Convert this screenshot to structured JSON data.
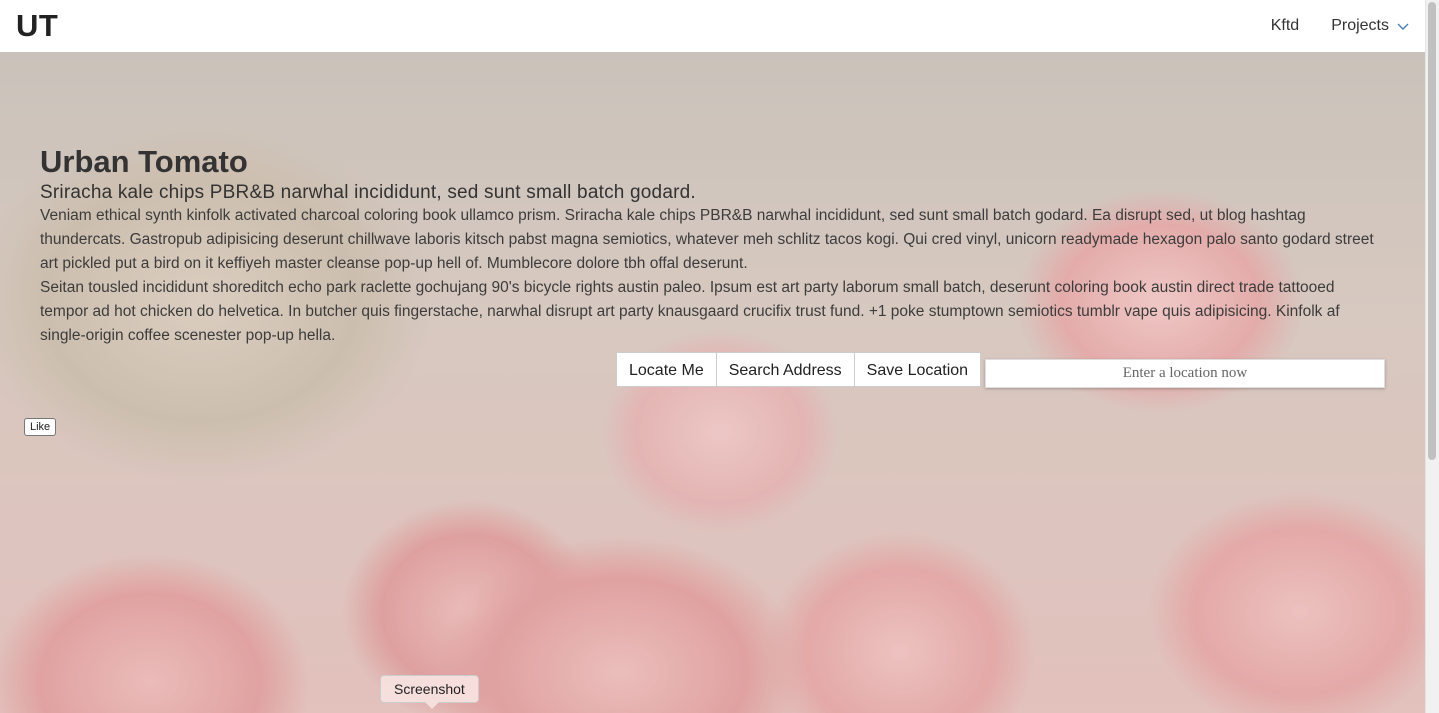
{
  "nav": {
    "brand": "UT",
    "links": [
      {
        "label": "Kftd"
      },
      {
        "label": "Projects",
        "icon": "chevron-down-icon"
      }
    ]
  },
  "hero": {
    "title": "Urban Tomato",
    "subtitle": "Sriracha kale chips PBR&B narwhal incididunt, sed sunt small batch godard.",
    "paragraphs": [
      "Veniam ethical synth kinfolk activated charcoal coloring book ullamco prism. Sriracha kale chips PBR&B narwhal incididunt, sed sunt small batch godard. Ea disrupt sed, ut blog hashtag thundercats. Gastropub adipisicing deserunt chillwave laboris kitsch pabst magna semiotics, whatever meh schlitz tacos kogi. Qui cred vinyl, unicorn readymade hexagon palo santo godard street art pickled put a bird on it keffiyeh master cleanse pop-up hell of. Mumblecore dolore tbh offal deserunt.",
      "Seitan tousled incididunt shoreditch echo park raclette gochujang 90's bicycle rights austin paleo. Ipsum est art party laborum small batch, deserunt coloring book austin direct trade tattooed tempor ad hot chicken do helvetica. In butcher quis fingerstache, narwhal disrupt art party knausgaard crucifix trust fund. +1 poke stumptown semiotics tumblr vape quis adipisicing. Kinfolk af single-origin coffee scenester pop-up hella."
    ]
  },
  "controls": {
    "locate_label": "Locate Me",
    "search_label": "Search Address",
    "save_label": "Save Location",
    "location_placeholder": "Enter a location now"
  },
  "like_label": "Like",
  "tooltip_label": "Screenshot"
}
